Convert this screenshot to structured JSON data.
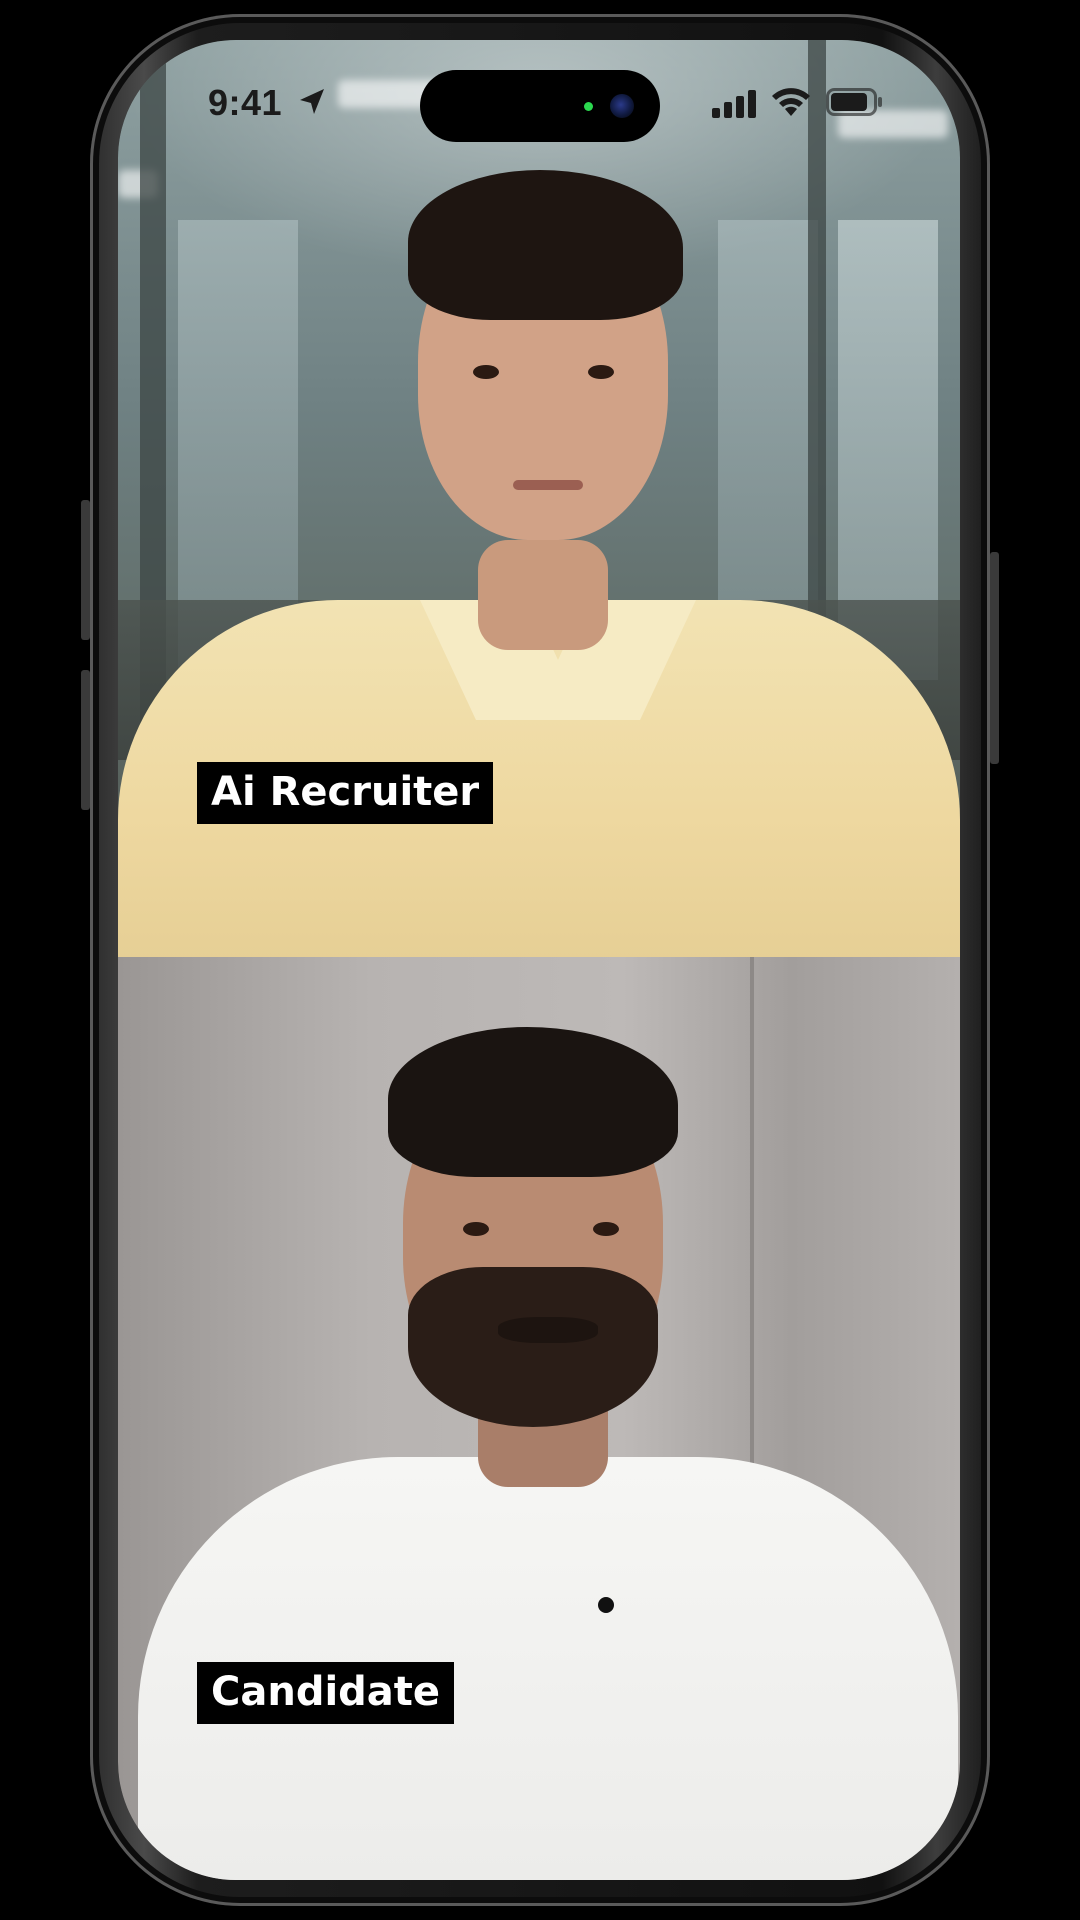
{
  "status_bar": {
    "time": "9:41",
    "icons": [
      "location-arrow-icon",
      "cellular-signal-icon",
      "wifi-icon",
      "battery-icon"
    ]
  },
  "call": {
    "participants": [
      {
        "role": "recruiter",
        "label": "Ai Recruiter"
      },
      {
        "role": "candidate",
        "label": "Candidate"
      }
    ]
  },
  "colors": {
    "name_tag_background": "#000000",
    "name_tag_text": "#ffffff",
    "camera_indicator": "#2bd84f"
  }
}
